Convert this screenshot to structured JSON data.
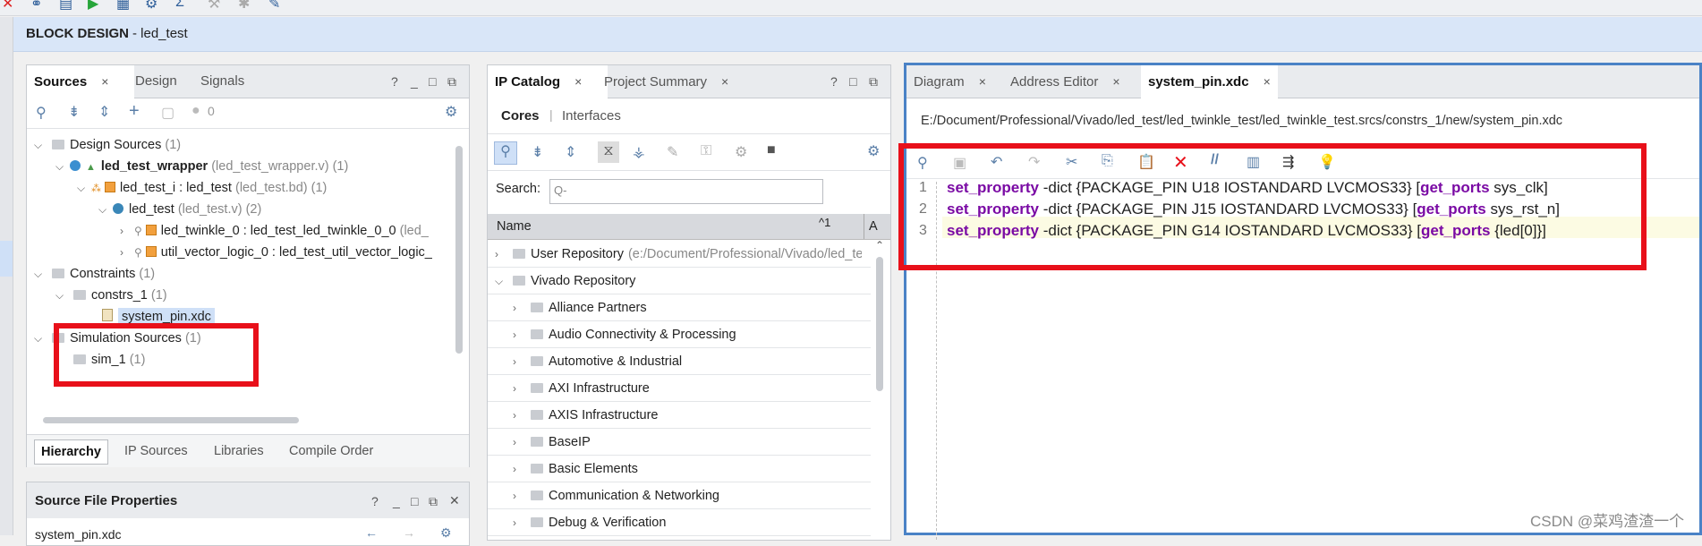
{
  "header": {
    "title": "BLOCK DESIGN",
    "subtitle": "- led_test"
  },
  "sources_panel": {
    "tabs": [
      {
        "label": "Sources",
        "close": "×"
      },
      {
        "label": "Design"
      },
      {
        "label": "Signals"
      }
    ],
    "help": "?",
    "count_badge": "0",
    "tree": [
      {
        "label": "Design Sources",
        "extra": "(1)"
      },
      {
        "label": "led_test_wrapper",
        "extra": "(led_test_wrapper.v) (1)"
      },
      {
        "label": "led_test_i : led_test",
        "extra": "(led_test.bd) (1)"
      },
      {
        "label": "led_test",
        "extra": "(led_test.v) (2)"
      },
      {
        "label": "led_twinkle_0 : led_test_led_twinkle_0_0",
        "extra": "(led_"
      },
      {
        "label": "util_vector_logic_0 : led_test_util_vector_logic_",
        "extra": ""
      },
      {
        "label": "Constraints",
        "extra": "(1)"
      },
      {
        "label": "constrs_1",
        "extra": "(1)"
      },
      {
        "label": "system_pin.xdc",
        "extra": ""
      },
      {
        "label": "Simulation Sources",
        "extra": "(1)"
      },
      {
        "label": "sim_1",
        "extra": "(1)"
      }
    ],
    "bottom_tabs": [
      "Hierarchy",
      "IP Sources",
      "Libraries",
      "Compile Order"
    ]
  },
  "source_props": {
    "title": "Source File Properties",
    "file": "system_pin.xdc",
    "help": "?"
  },
  "ip_panel": {
    "tabs": [
      {
        "label": "IP Catalog",
        "close": "×"
      },
      {
        "label": "Project Summary",
        "close": "×"
      }
    ],
    "help": "?",
    "subtabs": [
      "Cores",
      "Interfaces"
    ],
    "search_label": "Search:",
    "search_placeholder": "Q-",
    "col_name": "Name",
    "col_sort": "^1",
    "col_second": "A",
    "rows": [
      {
        "label": "User Repository",
        "extra": "(e:/Document/Professional/Vivado/led_tes"
      },
      {
        "label": "Vivado Repository",
        "extra": ""
      },
      {
        "label": "Alliance Partners",
        "extra": ""
      },
      {
        "label": "Audio Connectivity & Processing",
        "extra": ""
      },
      {
        "label": "Automotive & Industrial",
        "extra": ""
      },
      {
        "label": "AXI Infrastructure",
        "extra": ""
      },
      {
        "label": "AXIS Infrastructure",
        "extra": ""
      },
      {
        "label": "BaseIP",
        "extra": ""
      },
      {
        "label": "Basic Elements",
        "extra": ""
      },
      {
        "label": "Communication & Networking",
        "extra": ""
      },
      {
        "label": "Debug & Verification",
        "extra": ""
      }
    ]
  },
  "editor": {
    "tabs": [
      {
        "label": "Diagram",
        "close": "×"
      },
      {
        "label": "Address Editor",
        "close": "×"
      },
      {
        "label": "system_pin.xdc",
        "close": "×"
      }
    ],
    "path": "E:/Document/Professional/Vivado/led_test/led_twinkle_test/led_twinkle_test.srcs/constrs_1/new/system_pin.xdc",
    "lines": [
      {
        "num": "1",
        "kw": "set_property",
        "mid": " -dict {PACKAGE_PIN U18 IOSTANDARD LVCMOS33} [",
        "kw2": "get_ports",
        "tail": " sys_clk]"
      },
      {
        "num": "2",
        "kw": "set_property",
        "mid": " -dict {PACKAGE_PIN J15 IOSTANDARD LVCMOS33} [",
        "kw2": "get_ports",
        "tail": " sys_rst_n]"
      },
      {
        "num": "3",
        "kw": "set_property",
        "mid": " -dict {PACKAGE_PIN G14 IOSTANDARD LVCMOS33} [",
        "kw2": "get_ports",
        "tail": " {led[0]}]"
      }
    ]
  },
  "watermark": "CSDN @菜鸡渣渣一个",
  "colors": {
    "highlight_red": "#e8101a",
    "keyword": "#7a0aa4",
    "header_bg": "#d9e6f8"
  }
}
